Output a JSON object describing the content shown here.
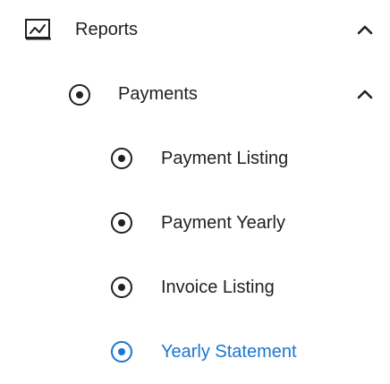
{
  "colors": {
    "text": "#212121",
    "icon": "#212121",
    "active": "#1976d2",
    "background": "#ffffff"
  },
  "nav": {
    "reports": {
      "label": "Reports",
      "icon": "report-chart-icon",
      "expanded": true
    },
    "payments": {
      "label": "Payments",
      "icon": "radio-dot-icon",
      "expanded": true,
      "items": [
        {
          "label": "Payment Listing",
          "icon": "radio-dot-icon",
          "active": false
        },
        {
          "label": "Payment Yearly",
          "icon": "radio-dot-icon",
          "active": false
        },
        {
          "label": "Invoice Listing",
          "icon": "radio-dot-icon",
          "active": false
        },
        {
          "label": "Yearly Statement",
          "icon": "radio-dot-icon",
          "active": true
        }
      ]
    }
  }
}
